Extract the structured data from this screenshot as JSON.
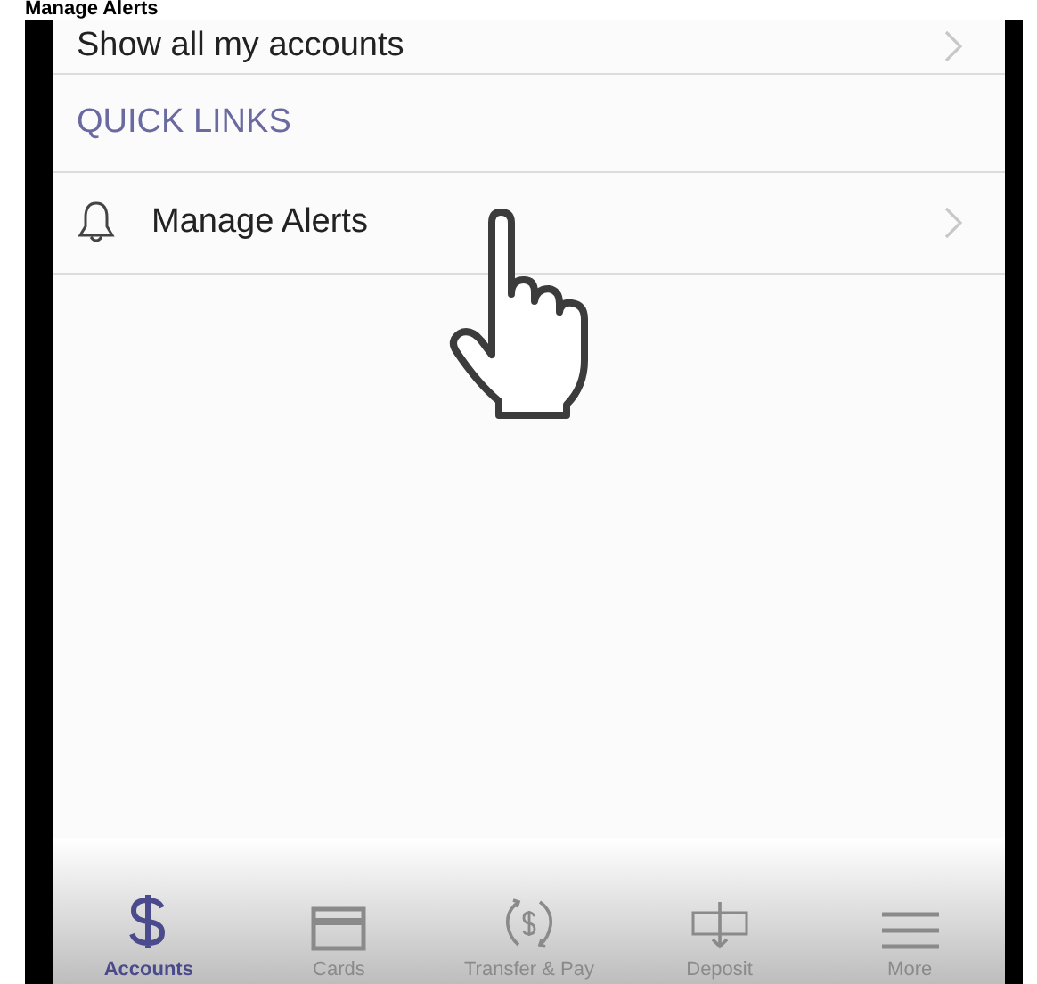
{
  "caption": "Manage Alerts",
  "rows": [
    {
      "kind": "link",
      "label": "Show all my accounts"
    },
    {
      "kind": "header",
      "label": "QUICK LINKS"
    },
    {
      "kind": "alert",
      "label": "Manage Alerts"
    }
  ],
  "tabs": [
    {
      "kind": "dollar",
      "label": "Accounts",
      "selected": true
    },
    {
      "kind": "card",
      "label": "Cards",
      "selected": false
    },
    {
      "kind": "transfer",
      "label": "Transfer & Pay",
      "selected": false
    },
    {
      "kind": "deposit",
      "label": "Deposit",
      "selected": false
    },
    {
      "kind": "menu",
      "label": "More",
      "selected": false
    }
  ]
}
